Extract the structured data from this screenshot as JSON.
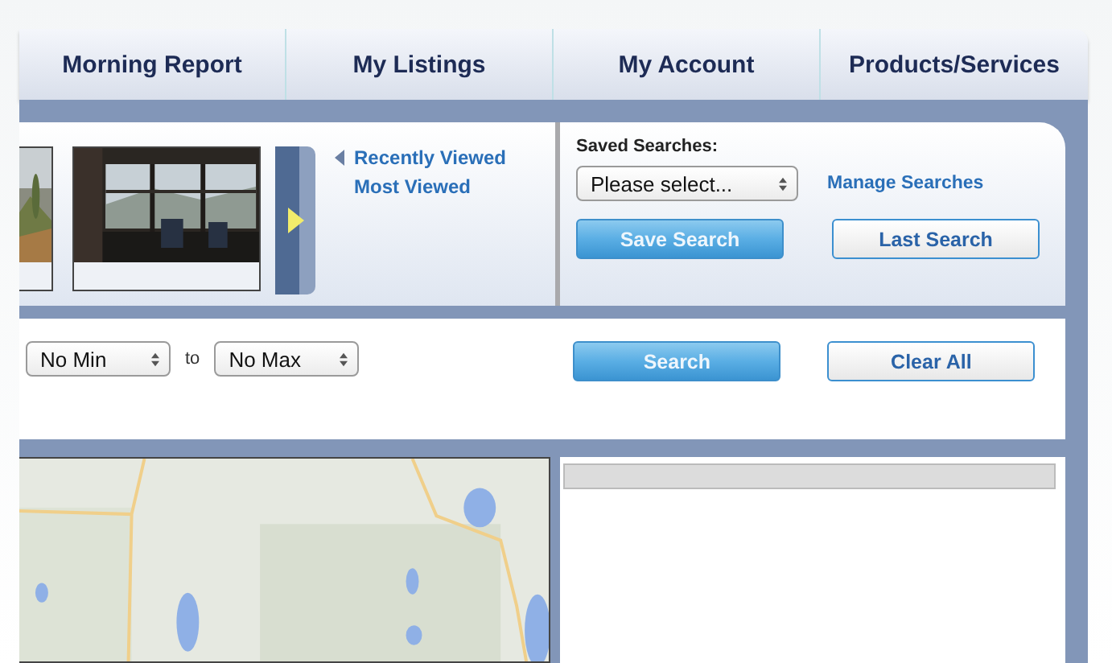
{
  "tabs": [
    {
      "label": "Morning Report"
    },
    {
      "label": "My Listings"
    },
    {
      "label": "My Account"
    },
    {
      "label": "Products/Services"
    }
  ],
  "gallery": {
    "links": [
      {
        "label": "Recently Viewed",
        "kind": "collapsible"
      },
      {
        "label": "Most Viewed",
        "kind": "plain"
      }
    ]
  },
  "saved_searches": {
    "label": "Saved Searches:",
    "select": "Please select...",
    "manage_link": "Manage Searches",
    "buttons": [
      {
        "label": "Save Search",
        "kind": "primary"
      },
      {
        "label": "Last Search",
        "kind": "secondary"
      }
    ]
  },
  "filters": {
    "min": "No Min",
    "separator": "to",
    "max": "No Max",
    "buttons": [
      {
        "label": "Search",
        "kind": "primary"
      },
      {
        "label": "Clear All",
        "kind": "secondary"
      }
    ]
  }
}
